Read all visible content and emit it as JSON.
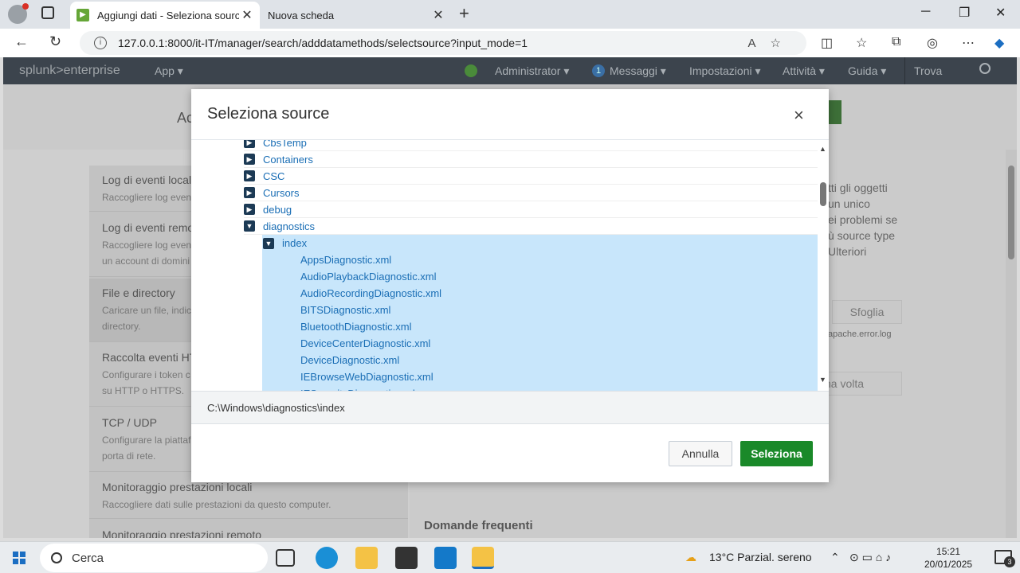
{
  "browser": {
    "active_tab_title": "Aggiungi dati - Seleziona source |",
    "inactive_tab_title": "Nuova scheda",
    "url": "127.0.0.1:8000/it-IT/manager/search/adddatamethods/selectsource?input_mode=1"
  },
  "splunk": {
    "logo_main": "splunk>",
    "logo_sub": "enterprise",
    "app_menu": "App ▾",
    "admin_menu": "Administrator ▾",
    "messages_count": "1",
    "messages_menu": "Messaggi ▾",
    "settings_menu": "Impostazioni ▾",
    "activity_menu": "Attività ▾",
    "help_menu": "Guida ▾",
    "find": "Trova"
  },
  "background": {
    "page_title": "Ac",
    "items": [
      {
        "title": "Log di eventi locali",
        "desc": "Raccogliere log eventi"
      },
      {
        "title": "Log di eventi remo",
        "desc": "Raccogliere log eventi\nun account di domini"
      },
      {
        "title": "File e directory",
        "desc": "Caricare un file, indic\ndirectory."
      },
      {
        "title": "Raccolta eventi HT",
        "desc": "Configurare i token c\nsu HTTP o HTTPS."
      },
      {
        "title": "TCP / UDP",
        "desc": "Configurare la piattaf\nporta di rete."
      },
      {
        "title": "Monitoraggio prestazioni locali",
        "desc": "Raccogliere dati sulle prestazioni da questo computer."
      },
      {
        "title": "Monitoraggio prestazioni remoto",
        "desc": ""
      }
    ],
    "right_text": "tti gli oggetti\n un unico\nei problemi se\nù source type\n Ulteriori",
    "browse_button": "Sfoglia",
    "hint": "apache.error.log",
    "once": "na volta",
    "faq": "Domande frequenti"
  },
  "modal": {
    "title": "Seleziona source",
    "close": "×",
    "tree": [
      {
        "label": "CbsTemp",
        "level": 1,
        "type": "folder",
        "expanded": false,
        "selected": false
      },
      {
        "label": "Containers",
        "level": 1,
        "type": "folder",
        "expanded": false,
        "selected": false
      },
      {
        "label": "CSC",
        "level": 1,
        "type": "folder",
        "expanded": false,
        "selected": false
      },
      {
        "label": "Cursors",
        "level": 1,
        "type": "folder",
        "expanded": false,
        "selected": false
      },
      {
        "label": "debug",
        "level": 1,
        "type": "folder",
        "expanded": false,
        "selected": false
      },
      {
        "label": "diagnostics",
        "level": 1,
        "type": "folder",
        "expanded": true,
        "selected": false
      },
      {
        "label": "index",
        "level": 2,
        "type": "folder",
        "expanded": true,
        "selected": true
      },
      {
        "label": "AppsDiagnostic.xml",
        "level": 3,
        "type": "file",
        "selected": true
      },
      {
        "label": "AudioPlaybackDiagnostic.xml",
        "level": 3,
        "type": "file",
        "selected": true
      },
      {
        "label": "AudioRecordingDiagnostic.xml",
        "level": 3,
        "type": "file",
        "selected": true
      },
      {
        "label": "BITSDiagnostic.xml",
        "level": 3,
        "type": "file",
        "selected": true
      },
      {
        "label": "BluetoothDiagnostic.xml",
        "level": 3,
        "type": "file",
        "selected": true
      },
      {
        "label": "DeviceCenterDiagnostic.xml",
        "level": 3,
        "type": "file",
        "selected": true
      },
      {
        "label": "DeviceDiagnostic.xml",
        "level": 3,
        "type": "file",
        "selected": true
      },
      {
        "label": "IEBrowseWebDiagnostic.xml",
        "level": 3,
        "type": "file",
        "selected": true
      },
      {
        "label": "IESecurityDiagnostic.xml",
        "level": 3,
        "type": "file",
        "selected": true
      }
    ],
    "selected_path": "C:\\Windows\\diagnostics\\index",
    "cancel": "Annulla",
    "confirm": "Seleziona"
  },
  "taskbar": {
    "search": "Cerca",
    "weather": "13°C  Parzial. sereno",
    "time": "15:21",
    "date": "20/01/2025",
    "notifications": "3"
  },
  "colors": {
    "splunk_bar": "#3c444d",
    "link": "#1a6eb5",
    "selection": "#c8e6fb",
    "confirm": "#1a8929"
  }
}
